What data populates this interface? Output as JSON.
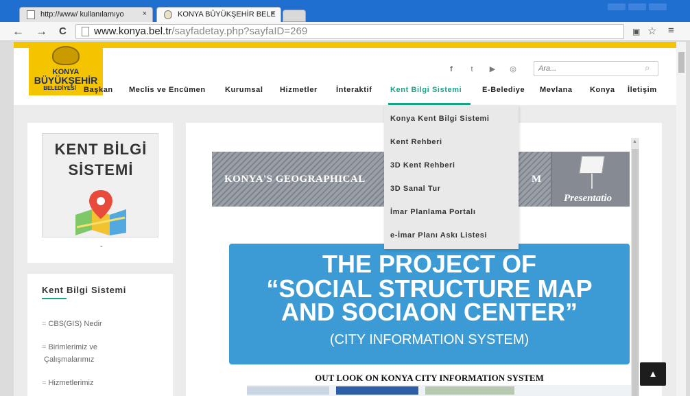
{
  "browser": {
    "tabs": [
      {
        "label": "http://www/ kullanılamıyo"
      },
      {
        "label": "KONYA BÜYÜKŞEHİR BELE"
      }
    ],
    "tab_close": "×",
    "url_host": "www.konya.bel.tr",
    "url_path": "/sayfadetay.php?sayfaID=269",
    "back": "←",
    "forward": "→",
    "reload": "C",
    "star": "☆",
    "menu": "≡"
  },
  "header": {
    "logo_line1": "KONYA",
    "logo_line2": "BÜYÜKŞEHİR",
    "logo_line3": "BELEDİYESİ",
    "social": [
      "f",
      "t",
      "▶",
      "◎"
    ],
    "search_placeholder": "Ara..."
  },
  "menu": {
    "items": [
      "Başkan",
      "Meclis ve Encümen",
      "Kurumsal",
      "Hizmetler",
      "İnteraktif",
      "Kent Bilgi Sistemi",
      "E-Belediye",
      "Mevlana",
      "Konya",
      "İletişim"
    ],
    "active": "Kent Bilgi Sistemi"
  },
  "dropdown": {
    "items": [
      "Konya Kent Bilgi Sistemi",
      "Kent Rehberi",
      "3D Kent Rehberi",
      "3D Sanal Tur",
      "İmar Planlama Portalı",
      "e-İmar Planı Askı Listesi"
    ]
  },
  "sidebar": {
    "card_title_line1": "KENT BİLGİ",
    "card_title_line2": "SİSTEMİ",
    "card_dot": "-",
    "section_title": "Kent Bilgi Sistemi",
    "links": [
      {
        "dash": "=",
        "label": "CBS(GIS) Nedir"
      },
      {
        "dash": "=",
        "label": "Birimlerimiz ve"
      },
      {
        "dash": "",
        "label": "Çalışmalarımız"
      },
      {
        "dash": "=",
        "label": "Hizmetlerimiz"
      }
    ]
  },
  "main": {
    "geo_text_left": "KONYA'S GEOGRAPHICAL",
    "geo_text_right": "M",
    "presentation_label": "Presentatio",
    "project_lines": [
      "THE PROJECT OF",
      "“SOCIAL STRUCTURE MAP",
      "AND SOCIAON CENTER”",
      "(CITY INFORMATION SYSTEM)"
    ],
    "outlook_title": "OUT LOOK ON KONYA CITY INFORMATION SYSTEM",
    "back_to_top": "▲"
  },
  "colors": {
    "accent": "#17a589",
    "brand_yellow": "#f5c400",
    "banner_blue": "#3c9bd5",
    "chrome_blue": "#1f6fd1"
  }
}
